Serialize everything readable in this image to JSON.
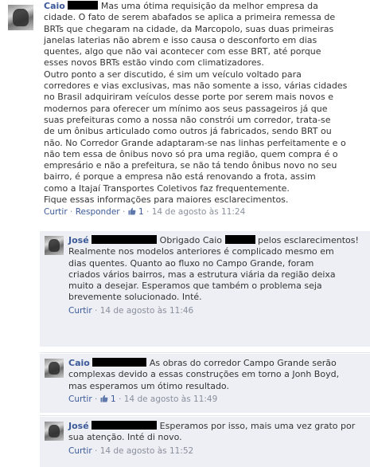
{
  "comments": [
    {
      "author": "Caio",
      "text_lines": [
        "Mas uma ótima requisição da melhor empresa da",
        "cidade. O fato de serem abafados se aplica a primeira remessa de",
        "BRTs que chegaram na cidade, da Marcopolo, suas duas primeiras",
        "janelas laterias não abrem e isso causa o desconforto em dias",
        "quentes, algo que não vai acontecer com esse BRT, até porque",
        "esses novos BRTs estão vindo com climatizadores.",
        "Outro ponto a ser discutido, é sim um veículo voltado para",
        "corredores e vias exclusivas, mas não somente a isso, várias cidades",
        "no Brasil adquiriram veículos desse porte por serem mais novos e",
        "modernos para oferecer um mínimo aos seus passageiros já que",
        "suas prefeituras como a nossa não constrói um corredor, trata-se",
        "de um ônibus articulado como outros já fabricados, sendo BRT ou",
        "não. No Corredor Grande adaptaram-se nas linhas perfeitamente e o",
        "não tem essa de ônibus novo só pra uma região, quem compra é o",
        "empresário e não a prefeitura, se não tá tendo ônibus novo no seu",
        "bairro, é porque a empresa não está renovando a frota, assim",
        "como a Itajaí Transportes Coletivos faz frequentemente.",
        "Fique essas informações para maiores esclarecimentos."
      ],
      "meta": {
        "curtir": "Curtir",
        "responder": "Responder",
        "likes": "1",
        "timestamp": "14 de agosto às 11:24"
      }
    },
    {
      "author": "José",
      "text_lines": [
        "Obrigado Caio",
        "pelos esclarecimentos!",
        "Realmente nos modelos anteriores é complicado mesmo em",
        "dias quentes. Quanto ao fluxo no Campo Grande, foram",
        "criados vários bairros, mas a estrutura viária da região deixa",
        "muito a desejar. Esperamos que também o problema seja",
        "brevemente solucionado. Inté."
      ],
      "meta": {
        "curtir": "Curtir",
        "timestamp": "14 de agosto às 11:46"
      }
    },
    {
      "author": "Caio",
      "text_lines": [
        "As obras do corredor Campo Grande serão",
        "complexas devido a essas construções em torno a Jonh Boyd,",
        "mas esperamos um ótimo resultado."
      ],
      "meta": {
        "curtir": "Curtir",
        "likes": "1",
        "timestamp": "14 de agosto às 11:49"
      }
    },
    {
      "author": "José",
      "text_lines": [
        "Esperamos por isso, mais uma vez grato por",
        "sua atenção. Inté di novo."
      ],
      "meta": {
        "curtir": "Curtir",
        "timestamp": "14 de agosto às 11:52"
      }
    }
  ],
  "meta_separator": "·",
  "colors": {
    "link": "#3b5998",
    "reply_bg": "#edeff4",
    "meta_text": "#898f9c"
  }
}
